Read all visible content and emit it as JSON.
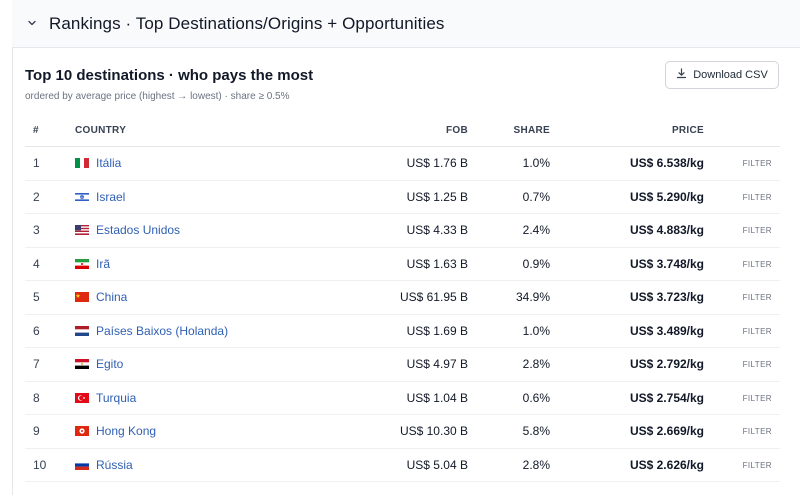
{
  "section": {
    "title": "Rankings · Top Destinations/Origins + Opportunities"
  },
  "card": {
    "title": "Top 10 destinations · who pays the most",
    "subtitle": "ordered by average price (highest → lowest) · share ≥ 0.5%",
    "download_label": "Download CSV"
  },
  "table": {
    "headers": {
      "rank": "#",
      "country": "COUNTRY",
      "fob": "FOB",
      "share": "SHARE",
      "price": "PRICE"
    },
    "filter_label": "FILTER",
    "rows": [
      {
        "rank": "1",
        "flag": "italy-flag-icon",
        "country": "Itália",
        "fob": "US$ 1.76 B",
        "share": "1.0%",
        "price": "US$ 6.538/kg"
      },
      {
        "rank": "2",
        "flag": "israel-flag-icon",
        "country": "Israel",
        "fob": "US$ 1.25 B",
        "share": "0.7%",
        "price": "US$ 5.290/kg"
      },
      {
        "rank": "3",
        "flag": "usa-flag-icon",
        "country": "Estados Unidos",
        "fob": "US$ 4.33 B",
        "share": "2.4%",
        "price": "US$ 4.883/kg"
      },
      {
        "rank": "4",
        "flag": "iran-flag-icon",
        "country": "Irã",
        "fob": "US$ 1.63 B",
        "share": "0.9%",
        "price": "US$ 3.748/kg"
      },
      {
        "rank": "5",
        "flag": "china-flag-icon",
        "country": "China",
        "fob": "US$ 61.95 B",
        "share": "34.9%",
        "price": "US$ 3.723/kg"
      },
      {
        "rank": "6",
        "flag": "netherlands-flag-icon",
        "country": "Países Baixos (Holanda)",
        "fob": "US$ 1.69 B",
        "share": "1.0%",
        "price": "US$ 3.489/kg"
      },
      {
        "rank": "7",
        "flag": "egypt-flag-icon",
        "country": "Egito",
        "fob": "US$ 4.97 B",
        "share": "2.8%",
        "price": "US$ 2.792/kg"
      },
      {
        "rank": "8",
        "flag": "turkey-flag-icon",
        "country": "Turquia",
        "fob": "US$ 1.04 B",
        "share": "0.6%",
        "price": "US$ 2.754/kg"
      },
      {
        "rank": "9",
        "flag": "hong-kong-flag-icon",
        "country": "Hong Kong",
        "fob": "US$ 10.30 B",
        "share": "5.8%",
        "price": "US$ 2.669/kg"
      },
      {
        "rank": "10",
        "flag": "russia-flag-icon",
        "country": "Rússia",
        "fob": "US$ 5.04 B",
        "share": "2.8%",
        "price": "US$ 2.626/kg"
      }
    ]
  },
  "colors": {
    "link": "#2f5fb3",
    "header_bg": "#f9fafb",
    "border": "#e5e7eb"
  }
}
